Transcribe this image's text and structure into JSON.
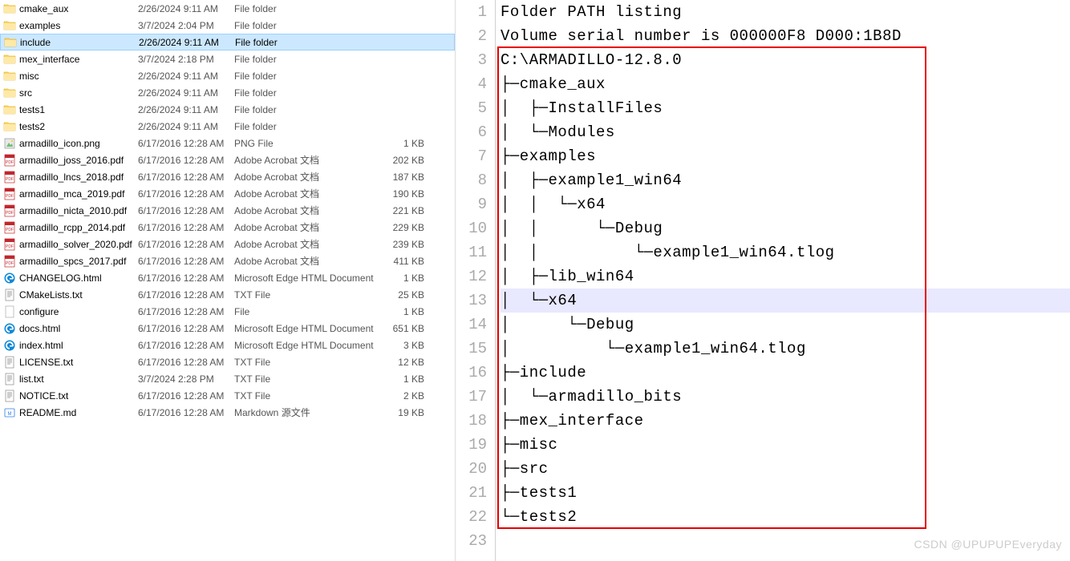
{
  "file_list": [
    {
      "icon": "folder",
      "name": "cmake_aux",
      "date": "2/26/2024 9:11 AM",
      "type": "File folder",
      "size": "",
      "selected": false
    },
    {
      "icon": "folder",
      "name": "examples",
      "date": "3/7/2024 2:04 PM",
      "type": "File folder",
      "size": "",
      "selected": false
    },
    {
      "icon": "folder",
      "name": "include",
      "date": "2/26/2024 9:11 AM",
      "type": "File folder",
      "size": "",
      "selected": true
    },
    {
      "icon": "folder",
      "name": "mex_interface",
      "date": "3/7/2024 2:18 PM",
      "type": "File folder",
      "size": "",
      "selected": false
    },
    {
      "icon": "folder",
      "name": "misc",
      "date": "2/26/2024 9:11 AM",
      "type": "File folder",
      "size": "",
      "selected": false
    },
    {
      "icon": "folder",
      "name": "src",
      "date": "2/26/2024 9:11 AM",
      "type": "File folder",
      "size": "",
      "selected": false
    },
    {
      "icon": "folder",
      "name": "tests1",
      "date": "2/26/2024 9:11 AM",
      "type": "File folder",
      "size": "",
      "selected": false
    },
    {
      "icon": "folder",
      "name": "tests2",
      "date": "2/26/2024 9:11 AM",
      "type": "File folder",
      "size": "",
      "selected": false
    },
    {
      "icon": "png",
      "name": "armadillo_icon.png",
      "date": "6/17/2016 12:28 AM",
      "type": "PNG File",
      "size": "1 KB",
      "selected": false
    },
    {
      "icon": "pdf",
      "name": "armadillo_joss_2016.pdf",
      "date": "6/17/2016 12:28 AM",
      "type": "Adobe Acrobat 文档",
      "size": "202 KB",
      "selected": false
    },
    {
      "icon": "pdf",
      "name": "armadillo_lncs_2018.pdf",
      "date": "6/17/2016 12:28 AM",
      "type": "Adobe Acrobat 文档",
      "size": "187 KB",
      "selected": false
    },
    {
      "icon": "pdf",
      "name": "armadillo_mca_2019.pdf",
      "date": "6/17/2016 12:28 AM",
      "type": "Adobe Acrobat 文档",
      "size": "190 KB",
      "selected": false
    },
    {
      "icon": "pdf",
      "name": "armadillo_nicta_2010.pdf",
      "date": "6/17/2016 12:28 AM",
      "type": "Adobe Acrobat 文档",
      "size": "221 KB",
      "selected": false
    },
    {
      "icon": "pdf",
      "name": "armadillo_rcpp_2014.pdf",
      "date": "6/17/2016 12:28 AM",
      "type": "Adobe Acrobat 文档",
      "size": "229 KB",
      "selected": false
    },
    {
      "icon": "pdf",
      "name": "armadillo_solver_2020.pdf",
      "date": "6/17/2016 12:28 AM",
      "type": "Adobe Acrobat 文档",
      "size": "239 KB",
      "selected": false
    },
    {
      "icon": "pdf",
      "name": "armadillo_spcs_2017.pdf",
      "date": "6/17/2016 12:28 AM",
      "type": "Adobe Acrobat 文档",
      "size": "411 KB",
      "selected": false
    },
    {
      "icon": "edge",
      "name": "CHANGELOG.html",
      "date": "6/17/2016 12:28 AM",
      "type": "Microsoft Edge HTML Document",
      "size": "1 KB",
      "selected": false
    },
    {
      "icon": "txt",
      "name": "CMakeLists.txt",
      "date": "6/17/2016 12:28 AM",
      "type": "TXT File",
      "size": "25 KB",
      "selected": false
    },
    {
      "icon": "file",
      "name": "configure",
      "date": "6/17/2016 12:28 AM",
      "type": "File",
      "size": "1 KB",
      "selected": false
    },
    {
      "icon": "edge",
      "name": "docs.html",
      "date": "6/17/2016 12:28 AM",
      "type": "Microsoft Edge HTML Document",
      "size": "651 KB",
      "selected": false
    },
    {
      "icon": "edge",
      "name": "index.html",
      "date": "6/17/2016 12:28 AM",
      "type": "Microsoft Edge HTML Document",
      "size": "3 KB",
      "selected": false
    },
    {
      "icon": "txt",
      "name": "LICENSE.txt",
      "date": "6/17/2016 12:28 AM",
      "type": "TXT File",
      "size": "12 KB",
      "selected": false
    },
    {
      "icon": "txt",
      "name": "list.txt",
      "date": "3/7/2024 2:28 PM",
      "type": "TXT File",
      "size": "1 KB",
      "selected": false
    },
    {
      "icon": "txt",
      "name": "NOTICE.txt",
      "date": "6/17/2016 12:28 AM",
      "type": "TXT File",
      "size": "2 KB",
      "selected": false
    },
    {
      "icon": "md",
      "name": "README.md",
      "date": "6/17/2016 12:28 AM",
      "type": "Markdown 源文件",
      "size": "19 KB",
      "selected": false
    }
  ],
  "editor": {
    "lines": [
      "Folder PATH listing",
      "Volume serial number is 000000F8 D000:1B8D",
      "C:\\ARMADILLO-12.8.0",
      "├─cmake_aux",
      "│  ├─InstallFiles",
      "│  └─Modules",
      "├─examples",
      "│  ├─example1_win64",
      "│  │  └─x64",
      "│  │      └─Debug",
      "│  │          └─example1_win64.tlog",
      "│  ├─lib_win64",
      "│  └─x64",
      "│      └─Debug",
      "│          └─example1_win64.tlog",
      "├─include",
      "│  └─armadillo_bits",
      "├─mex_interface",
      "├─misc",
      "├─src",
      "├─tests1",
      "└─tests2",
      ""
    ],
    "highlighted_line_index": 12,
    "total_lines": 23
  },
  "annotation": {
    "box": {
      "top_line": 3,
      "bottom_line": 22
    }
  },
  "watermark": "CSDN @UPUPUPEveryday"
}
